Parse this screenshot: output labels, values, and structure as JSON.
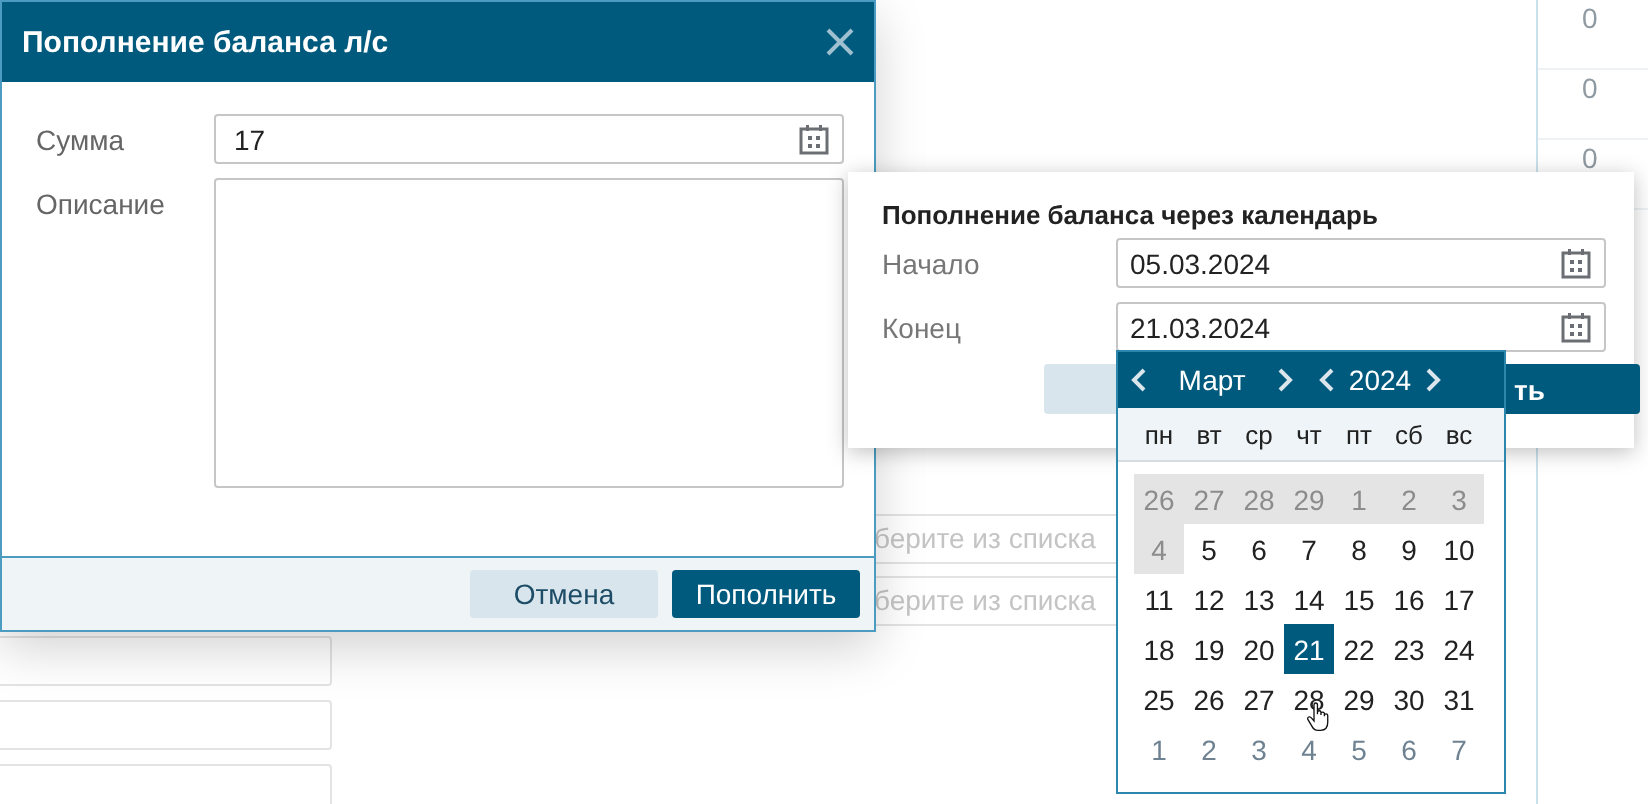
{
  "background": {
    "cells": [
      "0",
      "0",
      "0"
    ],
    "select_fields": [
      {
        "placeholder": "берите из списка"
      },
      {
        "placeholder": "берите из списка"
      }
    ]
  },
  "dialog": {
    "title": "Пополнение баланса л/с",
    "fields": [
      {
        "label": "Сумма",
        "kind": "date-input",
        "value": "17"
      },
      {
        "label": "Описание",
        "kind": "textarea"
      }
    ],
    "buttons": [
      {
        "label": "Отмена",
        "kind": "secondary"
      },
      {
        "label": "Пополнить",
        "kind": "primary"
      }
    ]
  },
  "calendar_panel": {
    "title": "Пополнение баланса через календарь",
    "fields": [
      {
        "label": "Начало",
        "value": "05.03.2024"
      },
      {
        "label": "Конец",
        "value": "21.03.2024"
      }
    ],
    "apply_button": "ть"
  },
  "calendar": {
    "month": "Март",
    "year": "2024",
    "weekdays": [
      "пн",
      "вт",
      "ср",
      "чт",
      "пт",
      "сб",
      "вс"
    ],
    "days": [
      {
        "day": "26",
        "other_month": true,
        "disabled": true,
        "selected": false
      },
      {
        "day": "27",
        "other_month": true,
        "disabled": true,
        "selected": false
      },
      {
        "day": "28",
        "other_month": true,
        "disabled": true,
        "selected": false
      },
      {
        "day": "29",
        "other_month": true,
        "disabled": true,
        "selected": false
      },
      {
        "day": "1",
        "other_month": false,
        "disabled": true,
        "selected": false
      },
      {
        "day": "2",
        "other_month": false,
        "disabled": true,
        "selected": false
      },
      {
        "day": "3",
        "other_month": false,
        "disabled": true,
        "selected": false
      },
      {
        "day": "4",
        "other_month": false,
        "disabled": true,
        "selected": false
      },
      {
        "day": "5",
        "other_month": false,
        "disabled": false,
        "selected": false
      },
      {
        "day": "6",
        "other_month": false,
        "disabled": false,
        "selected": false
      },
      {
        "day": "7",
        "other_month": false,
        "disabled": false,
        "selected": false
      },
      {
        "day": "8",
        "other_month": false,
        "disabled": false,
        "selected": false
      },
      {
        "day": "9",
        "other_month": false,
        "disabled": false,
        "selected": false
      },
      {
        "day": "10",
        "other_month": false,
        "disabled": false,
        "selected": false
      },
      {
        "day": "11",
        "other_month": false,
        "disabled": false,
        "selected": false
      },
      {
        "day": "12",
        "other_month": false,
        "disabled": false,
        "selected": false
      },
      {
        "day": "13",
        "other_month": false,
        "disabled": false,
        "selected": false
      },
      {
        "day": "14",
        "other_month": false,
        "disabled": false,
        "selected": false
      },
      {
        "day": "15",
        "other_month": false,
        "disabled": false,
        "selected": false
      },
      {
        "day": "16",
        "other_month": false,
        "disabled": false,
        "selected": false
      },
      {
        "day": "17",
        "other_month": false,
        "disabled": false,
        "selected": false
      },
      {
        "day": "18",
        "other_month": false,
        "disabled": false,
        "selected": false
      },
      {
        "day": "19",
        "other_month": false,
        "disabled": false,
        "selected": false
      },
      {
        "day": "20",
        "other_month": false,
        "disabled": false,
        "selected": false
      },
      {
        "day": "21",
        "other_month": false,
        "disabled": false,
        "selected": true
      },
      {
        "day": "22",
        "other_month": false,
        "disabled": false,
        "selected": false
      },
      {
        "day": "23",
        "other_month": false,
        "disabled": false,
        "selected": false
      },
      {
        "day": "24",
        "other_month": false,
        "disabled": false,
        "selected": false
      },
      {
        "day": "25",
        "other_month": false,
        "disabled": false,
        "selected": false
      },
      {
        "day": "26",
        "other_month": false,
        "disabled": false,
        "selected": false
      },
      {
        "day": "27",
        "other_month": false,
        "disabled": false,
        "selected": false
      },
      {
        "day": "28",
        "other_month": false,
        "disabled": false,
        "selected": false
      },
      {
        "day": "29",
        "other_month": false,
        "disabled": false,
        "selected": false
      },
      {
        "day": "30",
        "other_month": false,
        "disabled": false,
        "selected": false
      },
      {
        "day": "31",
        "other_month": false,
        "disabled": false,
        "selected": false
      },
      {
        "day": "1",
        "other_month": true,
        "disabled": false,
        "selected": false
      },
      {
        "day": "2",
        "other_month": true,
        "disabled": false,
        "selected": false
      },
      {
        "day": "3",
        "other_month": true,
        "disabled": false,
        "selected": false
      },
      {
        "day": "4",
        "other_month": true,
        "disabled": false,
        "selected": false
      },
      {
        "day": "5",
        "other_month": true,
        "disabled": false,
        "selected": false
      },
      {
        "day": "6",
        "other_month": true,
        "disabled": false,
        "selected": false
      },
      {
        "day": "7",
        "other_month": true,
        "disabled": false,
        "selected": false
      }
    ]
  }
}
